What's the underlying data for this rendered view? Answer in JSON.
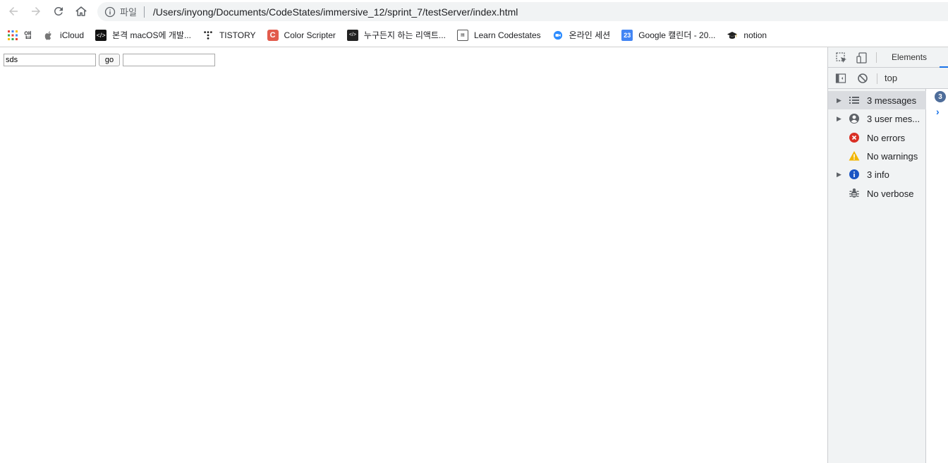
{
  "browser": {
    "address_scheme": "파일",
    "url": "/Users/inyong/Documents/CodeStates/immersive_12/sprint_7/testServer/index.html"
  },
  "bookmarks": [
    {
      "label": "앱",
      "icon": "apps-grid-icon"
    },
    {
      "label": "iCloud",
      "icon": "apple-icon"
    },
    {
      "label": "본격 macOS에 개발...",
      "icon": "code-icon"
    },
    {
      "label": "TISTORY",
      "icon": "tistory-icon"
    },
    {
      "label": "Color Scripter",
      "icon": "color-scripter-icon"
    },
    {
      "label": "누구든지 하는 리액트...",
      "icon": "code-icon"
    },
    {
      "label": "Learn Codestates",
      "icon": "codestates-icon"
    },
    {
      "label": "온라인 세션",
      "icon": "zoom-icon"
    },
    {
      "label": "Google 캘린더 - 20...",
      "icon": "calendar-icon"
    },
    {
      "label": "notion",
      "icon": "graduation-cap-icon"
    }
  ],
  "page": {
    "input_value": "sds",
    "go_label": "go",
    "second_input_value": ""
  },
  "devtools": {
    "tab_elements": "Elements",
    "context": "top",
    "badge_count": "3",
    "sidebar": [
      {
        "label": "3 messages",
        "icon": "list-icon",
        "expandable": true,
        "selected": true
      },
      {
        "label": "3 user mes...",
        "icon": "user-icon",
        "expandable": true,
        "selected": false
      },
      {
        "label": "No errors",
        "icon": "error-icon",
        "expandable": false,
        "selected": false
      },
      {
        "label": "No warnings",
        "icon": "warning-icon",
        "expandable": false,
        "selected": false
      },
      {
        "label": "3 info",
        "icon": "info-icon",
        "expandable": true,
        "selected": false
      },
      {
        "label": "No verbose",
        "icon": "bug-icon",
        "expandable": false,
        "selected": false
      }
    ]
  },
  "colors": {
    "accent": "#1a73e8",
    "error": "#d93025",
    "warning": "#f2b600",
    "info": "#1a55c4"
  }
}
